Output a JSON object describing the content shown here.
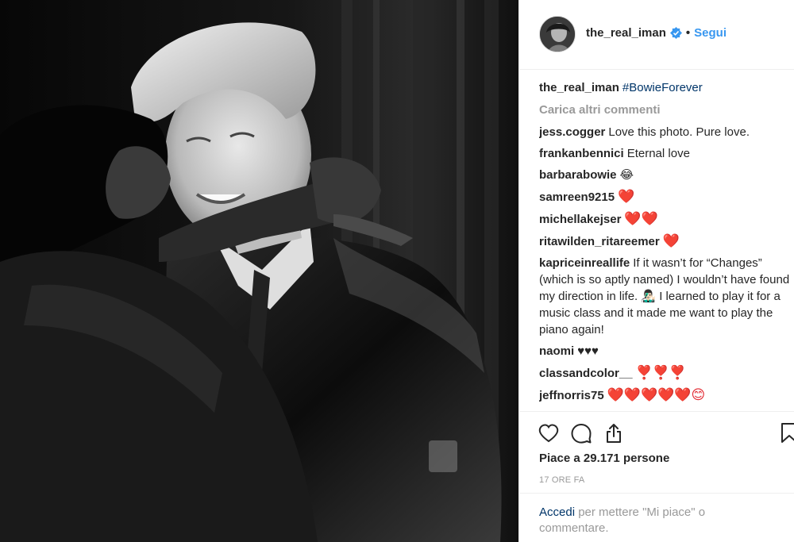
{
  "post": {
    "author": "the_real_iman",
    "follow_label": "Segui",
    "separator": "•"
  },
  "caption": {
    "user": "the_real_iman",
    "text": "#BowieForever"
  },
  "load_more_label": "Carica altri commenti",
  "comments": [
    {
      "user": "jess.cogger",
      "text": "Love this photo. Pure love."
    },
    {
      "user": "frankanbennici",
      "text": "Eternal love"
    },
    {
      "user": "barbarabowie",
      "text": "😂"
    },
    {
      "user": "samreen9215",
      "text": "❤️"
    },
    {
      "user": "michellakejser",
      "text": "❤️❤️"
    },
    {
      "user": "ritawilden_ritareemer",
      "text": "❤️"
    },
    {
      "user": "kapriceinreallife",
      "text": "If it wasn’t for “Changes” (which is so aptly named) I wouldn’t have found my direction in life. 👨🏻‍🎤 I learned to play it for a music class and it made me want to play the piano again!"
    },
    {
      "user": "naomi",
      "text": "♥♥♥"
    },
    {
      "user": "classandcolor__",
      "text": "❣️❣️❣️"
    },
    {
      "user": "jeffnorris75",
      "text": "❤️❤️❤️❤️❤️😊"
    }
  ],
  "actions": {
    "likes_prefix": "Piace a",
    "likes_count": "29.171",
    "likes_suffix": "persone",
    "timestamp": "17 ORE FA",
    "login_link": "Accedi",
    "login_text": "per mettere \"Mi piace\" o commentare."
  },
  "icons": {
    "like": "heart-icon",
    "comment": "comment-icon",
    "share": "share-icon",
    "save": "bookmark-icon",
    "verified": "verified-badge-icon"
  },
  "colors": {
    "link_blue": "#3897f0",
    "hashtag": "#003569",
    "muted": "#999999",
    "text": "#262626",
    "heart_red": "#e2262e"
  }
}
